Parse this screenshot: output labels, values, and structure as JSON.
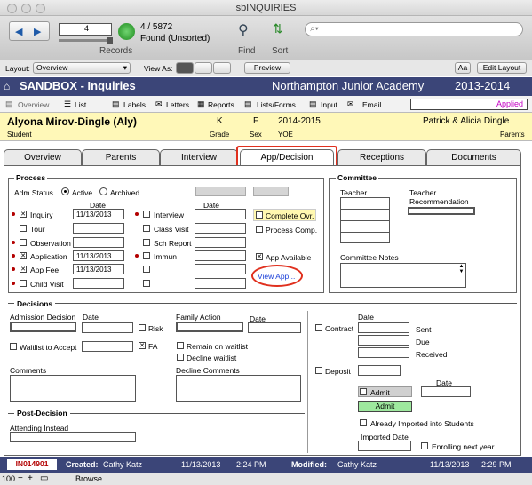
{
  "window": {
    "title": "sbINQUIRIES"
  },
  "toolbar": {
    "record_number": "4",
    "records_count": "4 / 5872",
    "found_status": "Found (Unsorted)",
    "records_label": "Records",
    "find_label": "Find",
    "sort_label": "Sort"
  },
  "layoutbar": {
    "layout_label": "Layout:",
    "layout_value": "Overview",
    "view_as_label": "View As:",
    "preview_label": "Preview",
    "aa_label": "Aa",
    "edit_layout_label": "Edit Layout"
  },
  "header": {
    "app_title": "SANDBOX - Inquiries",
    "school": "Northampton Junior Academy",
    "year": "2013-2014"
  },
  "nav": {
    "overview": "Overview",
    "list": "List",
    "labels": "Labels",
    "letters": "Letters",
    "reports": "Reports",
    "lists_forms": "Lists/Forms",
    "input": "Input",
    "email": "Email",
    "status": "Applied"
  },
  "student": {
    "name": "Alyona Mirov-Dingle (Aly)",
    "grade": "K",
    "sex": "F",
    "yoe": "2014-2015",
    "parents": "Patrick & Alicia Dingle",
    "student_label": "Student",
    "grade_label": "Grade",
    "sex_label": "Sex",
    "yoe_label": "YOE",
    "parents_label": "Parents"
  },
  "tabs": [
    "Overview",
    "Parents",
    "Interview",
    "App/Decision",
    "Receptions",
    "Documents"
  ],
  "process": {
    "title": "Process",
    "adm_status_label": "Adm Status",
    "active_label": "Active",
    "archived_label": "Archived",
    "date_header": "Date",
    "left_items": [
      {
        "label": "Inquiry",
        "checked": true,
        "required": true,
        "date": "11/13/2013"
      },
      {
        "label": "Tour",
        "checked": false,
        "required": false,
        "date": ""
      },
      {
        "label": "Observation",
        "checked": false,
        "required": true,
        "date": ""
      },
      {
        "label": "Application",
        "checked": true,
        "required": true,
        "date": "11/13/2013"
      },
      {
        "label": "App Fee",
        "checked": true,
        "required": true,
        "date": "11/13/2013"
      },
      {
        "label": "Child Visit",
        "checked": false,
        "required": true,
        "date": ""
      }
    ],
    "mid_items": [
      {
        "label": "Interview",
        "required": true
      },
      {
        "label": "Class Visit",
        "required": false
      },
      {
        "label": "Sch Report",
        "required": false
      },
      {
        "label": "Immun",
        "required": true
      },
      {
        "label": "",
        "required": false
      },
      {
        "label": "",
        "required": false
      }
    ],
    "complete_ovr": "Complete Ovr.",
    "process_comp": "Process Comp.",
    "app_available": "App Available",
    "view_app": "View App..."
  },
  "committee": {
    "title": "Committee",
    "teacher_label": "Teacher",
    "teacher_rec_label": "Teacher Recommendation",
    "notes_label": "Committee Notes"
  },
  "decisions": {
    "title": "Decisions",
    "admission_decision": "Admission Decision",
    "date_label": "Date",
    "risk": "Risk",
    "fa": "FA",
    "waitlist_to_accept": "Waitlist to Accept",
    "comments": "Comments",
    "family_action": "Family Action",
    "remain_on_waitlist": "Remain on waitlist",
    "decline_waitlist": "Decline waitlist",
    "decline_comments": "Decline Comments",
    "contract": "Contract",
    "sent": "Sent",
    "due": "Due",
    "received": "Received",
    "deposit": "Deposit",
    "admit_checkbox": "Admit",
    "admit_button": "Admit",
    "already_imported": "Already Imported into Students",
    "imported_date": "Imported Date",
    "enrolling_next_year": "Enrolling next year"
  },
  "post_decision": {
    "title": "Post-Decision",
    "attending_instead": "Attending Instead"
  },
  "statusbar": {
    "record_id": "IN014901",
    "created_label": "Created:",
    "created_by": "Cathy Katz",
    "created_date": "11/13/2013",
    "created_time": "2:24 PM",
    "modified_label": "Modified:",
    "modified_by": "Cathy Katz",
    "modified_date": "11/13/2013",
    "modified_time": "2:29 PM"
  },
  "bottombar": {
    "zoom": "100",
    "mode": "Browse"
  },
  "colors": {
    "header_bg": "#3b4578",
    "student_bg": "#fff8b8",
    "admit_green": "#9ee89e",
    "highlight_red": "#e0301e"
  }
}
